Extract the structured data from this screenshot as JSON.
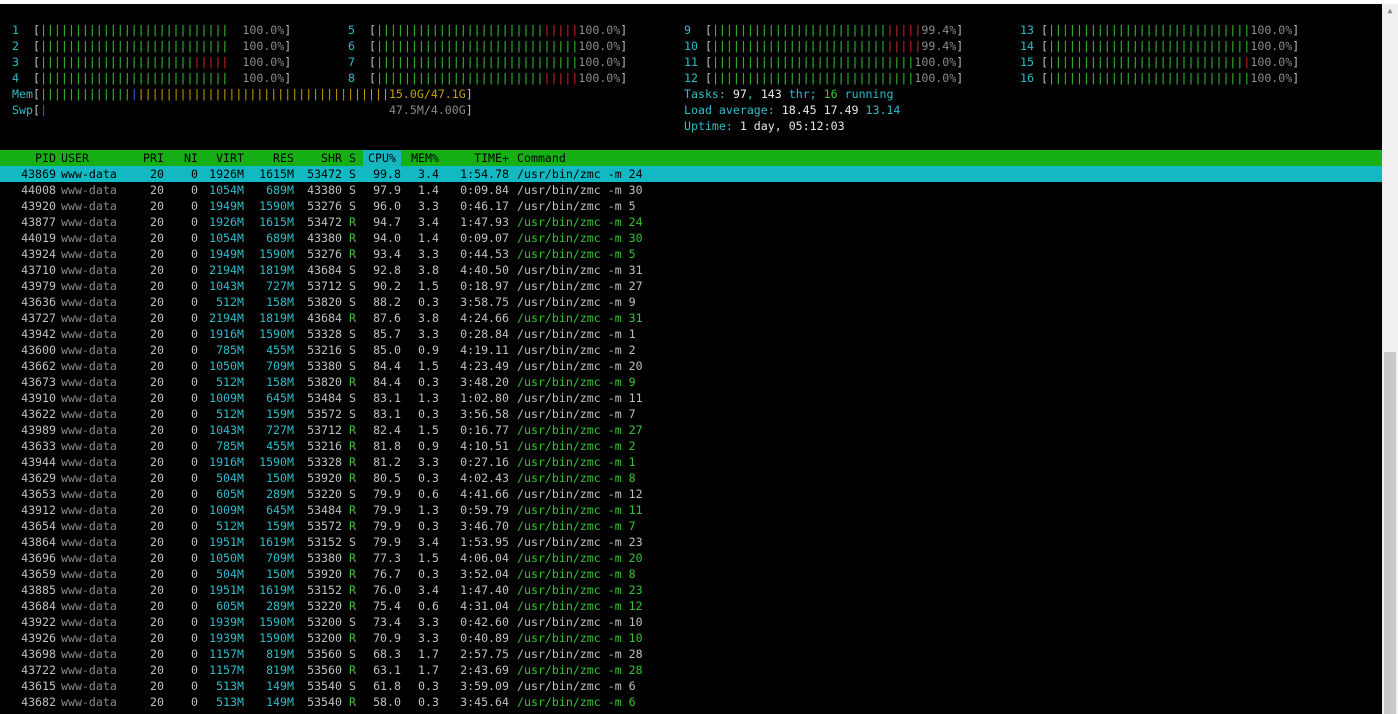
{
  "cpus": [
    {
      "id": "1",
      "pct": "100.0%",
      "g": 27,
      "r": 0
    },
    {
      "id": "2",
      "pct": "100.0%",
      "g": 27,
      "r": 0
    },
    {
      "id": "3",
      "pct": "100.0%",
      "g": 22,
      "r": 5
    },
    {
      "id": "4",
      "pct": "100.0%",
      "g": 27,
      "r": 0
    },
    {
      "id": "5",
      "pct": "100.0%",
      "g": 24,
      "r": 5
    },
    {
      "id": "6",
      "pct": "100.0%",
      "g": 29,
      "r": 0
    },
    {
      "id": "7",
      "pct": "100.0%",
      "g": 29,
      "r": 0
    },
    {
      "id": "8",
      "pct": "100.0%",
      "g": 24,
      "r": 5
    },
    {
      "id": "9",
      "pct": "99.4%",
      "g": 25,
      "r": 5
    },
    {
      "id": "10",
      "pct": "99.4%",
      "g": 25,
      "r": 5
    },
    {
      "id": "11",
      "pct": "100.0%",
      "g": 29,
      "r": 0
    },
    {
      "id": "12",
      "pct": "100.0%",
      "g": 29,
      "r": 0
    },
    {
      "id": "13",
      "pct": "100.0%",
      "g": 29,
      "r": 0
    },
    {
      "id": "14",
      "pct": "100.0%",
      "g": 29,
      "r": 0
    },
    {
      "id": "15",
      "pct": "100.0%",
      "g": 28,
      "r": 1
    },
    {
      "id": "16",
      "pct": "100.0%",
      "g": 29,
      "r": 0
    }
  ],
  "mem": {
    "label": "Mem",
    "value": "15.0G/47.1G",
    "used_fraction": 0.32
  },
  "swp": {
    "label": "Swp",
    "value": "47.5M/4.00G",
    "used_fraction": 0.01
  },
  "tasks": {
    "label": "Tasks: ",
    "count": "97",
    "sep": ", ",
    "thr": "143",
    "thr_label": " thr; ",
    "running": "16",
    "running_label": " running"
  },
  "load": {
    "label": "Load average: ",
    "v1": "18.45",
    "v2": "17.49",
    "v3": "13.14"
  },
  "uptime": {
    "label": "Uptime: ",
    "value": "1 day, 05:12:03"
  },
  "columns": [
    "PID",
    "USER",
    "PRI",
    "NI",
    "VIRT",
    "RES",
    "SHR",
    "S",
    "CPU%",
    "MEM%",
    "TIME+",
    "Command"
  ],
  "processes": [
    [
      "43869",
      "www-data",
      "20",
      "0",
      "1926M",
      "1615M",
      "53472",
      "S",
      "99.8",
      "3.4",
      "1:54.78",
      "/usr/bin/zmc -m 24"
    ],
    [
      "44008",
      "www-data",
      "20",
      "0",
      "1054M",
      "689M",
      "43380",
      "S",
      "97.9",
      "1.4",
      "0:09.84",
      "/usr/bin/zmc -m 30"
    ],
    [
      "43920",
      "www-data",
      "20",
      "0",
      "1949M",
      "1590M",
      "53276",
      "S",
      "96.0",
      "3.3",
      "0:46.17",
      "/usr/bin/zmc -m 5"
    ],
    [
      "43877",
      "www-data",
      "20",
      "0",
      "1926M",
      "1615M",
      "53472",
      "R",
      "94.7",
      "3.4",
      "1:47.93",
      "/usr/bin/zmc -m 24"
    ],
    [
      "44019",
      "www-data",
      "20",
      "0",
      "1054M",
      "689M",
      "43380",
      "R",
      "94.0",
      "1.4",
      "0:09.07",
      "/usr/bin/zmc -m 30"
    ],
    [
      "43924",
      "www-data",
      "20",
      "0",
      "1949M",
      "1590M",
      "53276",
      "R",
      "93.4",
      "3.3",
      "0:44.53",
      "/usr/bin/zmc -m 5"
    ],
    [
      "43710",
      "www-data",
      "20",
      "0",
      "2194M",
      "1819M",
      "43684",
      "S",
      "92.8",
      "3.8",
      "4:40.50",
      "/usr/bin/zmc -m 31"
    ],
    [
      "43979",
      "www-data",
      "20",
      "0",
      "1043M",
      "727M",
      "53712",
      "S",
      "90.2",
      "1.5",
      "0:18.97",
      "/usr/bin/zmc -m 27"
    ],
    [
      "43636",
      "www-data",
      "20",
      "0",
      "512M",
      "158M",
      "53820",
      "S",
      "88.2",
      "0.3",
      "3:58.75",
      "/usr/bin/zmc -m 9"
    ],
    [
      "43727",
      "www-data",
      "20",
      "0",
      "2194M",
      "1819M",
      "43684",
      "R",
      "87.6",
      "3.8",
      "4:24.66",
      "/usr/bin/zmc -m 31"
    ],
    [
      "43942",
      "www-data",
      "20",
      "0",
      "1916M",
      "1590M",
      "53328",
      "S",
      "85.7",
      "3.3",
      "0:28.84",
      "/usr/bin/zmc -m 1"
    ],
    [
      "43600",
      "www-data",
      "20",
      "0",
      "785M",
      "455M",
      "53216",
      "S",
      "85.0",
      "0.9",
      "4:19.11",
      "/usr/bin/zmc -m 2"
    ],
    [
      "43662",
      "www-data",
      "20",
      "0",
      "1050M",
      "709M",
      "53380",
      "S",
      "84.4",
      "1.5",
      "4:23.49",
      "/usr/bin/zmc -m 20"
    ],
    [
      "43673",
      "www-data",
      "20",
      "0",
      "512M",
      "158M",
      "53820",
      "R",
      "84.4",
      "0.3",
      "3:48.20",
      "/usr/bin/zmc -m 9"
    ],
    [
      "43910",
      "www-data",
      "20",
      "0",
      "1009M",
      "645M",
      "53484",
      "S",
      "83.1",
      "1.3",
      "1:02.80",
      "/usr/bin/zmc -m 11"
    ],
    [
      "43622",
      "www-data",
      "20",
      "0",
      "512M",
      "159M",
      "53572",
      "S",
      "83.1",
      "0.3",
      "3:56.58",
      "/usr/bin/zmc -m 7"
    ],
    [
      "43989",
      "www-data",
      "20",
      "0",
      "1043M",
      "727M",
      "53712",
      "R",
      "82.4",
      "1.5",
      "0:16.77",
      "/usr/bin/zmc -m 27"
    ],
    [
      "43633",
      "www-data",
      "20",
      "0",
      "785M",
      "455M",
      "53216",
      "R",
      "81.8",
      "0.9",
      "4:10.51",
      "/usr/bin/zmc -m 2"
    ],
    [
      "43944",
      "www-data",
      "20",
      "0",
      "1916M",
      "1590M",
      "53328",
      "R",
      "81.2",
      "3.3",
      "0:27.16",
      "/usr/bin/zmc -m 1"
    ],
    [
      "43629",
      "www-data",
      "20",
      "0",
      "504M",
      "150M",
      "53920",
      "R",
      "80.5",
      "0.3",
      "4:02.43",
      "/usr/bin/zmc -m 8"
    ],
    [
      "43653",
      "www-data",
      "20",
      "0",
      "605M",
      "289M",
      "53220",
      "S",
      "79.9",
      "0.6",
      "4:41.66",
      "/usr/bin/zmc -m 12"
    ],
    [
      "43912",
      "www-data",
      "20",
      "0",
      "1009M",
      "645M",
      "53484",
      "R",
      "79.9",
      "1.3",
      "0:59.79",
      "/usr/bin/zmc -m 11"
    ],
    [
      "43654",
      "www-data",
      "20",
      "0",
      "512M",
      "159M",
      "53572",
      "R",
      "79.9",
      "0.3",
      "3:46.70",
      "/usr/bin/zmc -m 7"
    ],
    [
      "43864",
      "www-data",
      "20",
      "0",
      "1951M",
      "1619M",
      "53152",
      "S",
      "79.9",
      "3.4",
      "1:53.95",
      "/usr/bin/zmc -m 23"
    ],
    [
      "43696",
      "www-data",
      "20",
      "0",
      "1050M",
      "709M",
      "53380",
      "R",
      "77.3",
      "1.5",
      "4:06.04",
      "/usr/bin/zmc -m 20"
    ],
    [
      "43659",
      "www-data",
      "20",
      "0",
      "504M",
      "150M",
      "53920",
      "R",
      "76.7",
      "0.3",
      "3:52.04",
      "/usr/bin/zmc -m 8"
    ],
    [
      "43885",
      "www-data",
      "20",
      "0",
      "1951M",
      "1619M",
      "53152",
      "R",
      "76.0",
      "3.4",
      "1:47.40",
      "/usr/bin/zmc -m 23"
    ],
    [
      "43684",
      "www-data",
      "20",
      "0",
      "605M",
      "289M",
      "53220",
      "R",
      "75.4",
      "0.6",
      "4:31.04",
      "/usr/bin/zmc -m 12"
    ],
    [
      "43922",
      "www-data",
      "20",
      "0",
      "1939M",
      "1590M",
      "53200",
      "S",
      "73.4",
      "3.3",
      "0:42.60",
      "/usr/bin/zmc -m 10"
    ],
    [
      "43926",
      "www-data",
      "20",
      "0",
      "1939M",
      "1590M",
      "53200",
      "R",
      "70.9",
      "3.3",
      "0:40.89",
      "/usr/bin/zmc -m 10"
    ],
    [
      "43698",
      "www-data",
      "20",
      "0",
      "1157M",
      "819M",
      "53560",
      "S",
      "68.3",
      "1.7",
      "2:57.75",
      "/usr/bin/zmc -m 28"
    ],
    [
      "43722",
      "www-data",
      "20",
      "0",
      "1157M",
      "819M",
      "53560",
      "R",
      "63.1",
      "1.7",
      "2:43.69",
      "/usr/bin/zmc -m 28"
    ],
    [
      "43615",
      "www-data",
      "20",
      "0",
      "513M",
      "149M",
      "53540",
      "S",
      "61.8",
      "0.3",
      "3:59.09",
      "/usr/bin/zmc -m 6"
    ],
    [
      "43682",
      "www-data",
      "20",
      "0",
      "513M",
      "149M",
      "53540",
      "R",
      "58.0",
      "0.3",
      "3:45.64",
      "/usr/bin/zmc -m 6"
    ]
  ],
  "colors": {
    "bg": "#000000",
    "header": "#16b016",
    "selected": "#12b9c3",
    "green": "#36c436",
    "red": "#d02525",
    "cyan": "#2ebdc9"
  }
}
